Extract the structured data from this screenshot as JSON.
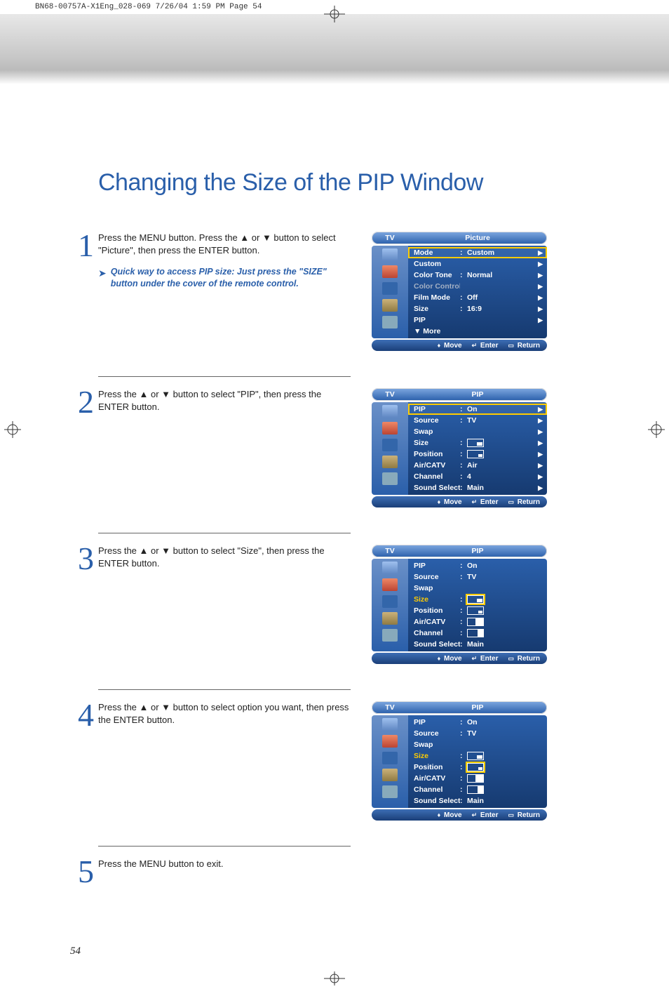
{
  "print_header": "BN68-00757A-X1Eng_028-069  7/26/04  1:59 PM  Page 54",
  "page_title": "Changing the Size of the PIP Window",
  "page_number": "54",
  "steps": [
    {
      "num": "1",
      "text": "Press the MENU button. Press the ▲ or ▼ button to select \"Picture\", then press the ENTER button.",
      "tip": "Quick way to access PIP size: Just press the \"SIZE\" button under the cover of the remote control."
    },
    {
      "num": "2",
      "text": "Press the ▲ or ▼ button to select \"PIP\", then press the ENTER button."
    },
    {
      "num": "3",
      "text": "Press the ▲ or ▼ button to select \"Size\", then press the ENTER button."
    },
    {
      "num": "4",
      "text": "Press the ▲ or ▼ button to select option you want, then press the ENTER button."
    },
    {
      "num": "5",
      "text": "Press the MENU button to exit."
    }
  ],
  "osd": {
    "tv_label": "TV",
    "footer": {
      "move": "Move",
      "enter": "Enter",
      "return": "Return"
    },
    "menu1": {
      "title": "Picture",
      "rows": [
        {
          "k": "Mode",
          "v": "Custom",
          "arr": true,
          "sel": true
        },
        {
          "k": "Custom",
          "v": "",
          "arr": true
        },
        {
          "k": "Color Tone",
          "v": "Normal",
          "arr": true
        },
        {
          "k": "Color Control",
          "v": "",
          "arr": true,
          "dim": true
        },
        {
          "k": "Film Mode",
          "v": "Off",
          "arr": true
        },
        {
          "k": "Size",
          "v": "16:9",
          "arr": true
        },
        {
          "k": "PIP",
          "v": "",
          "arr": true
        },
        {
          "k": "▼ More",
          "v": "",
          "arr": false
        }
      ]
    },
    "menu2": {
      "title": "PIP",
      "rows": [
        {
          "k": "PIP",
          "v": "On",
          "arr": true,
          "sel": true
        },
        {
          "k": "Source",
          "v": "TV",
          "arr": true
        },
        {
          "k": "Swap",
          "v": "",
          "arr": true
        },
        {
          "k": "Size",
          "v": "",
          "arr": true,
          "icon": "size-large"
        },
        {
          "k": "Position",
          "v": "",
          "arr": true,
          "icon": "pos"
        },
        {
          "k": "Air/CATV",
          "v": "Air",
          "arr": true
        },
        {
          "k": "Channel",
          "v": "4",
          "arr": true
        },
        {
          "k": "Sound Select",
          "v": "Main",
          "arr": true
        }
      ]
    },
    "menu3": {
      "title": "PIP",
      "rows": [
        {
          "k": "PIP",
          "v": "On"
        },
        {
          "k": "Source",
          "v": "TV"
        },
        {
          "k": "Swap",
          "v": ""
        },
        {
          "k": "Size",
          "v": "",
          "sizesel": true,
          "icon": "size-large",
          "sel_icon": true
        },
        {
          "k": "Position",
          "v": "",
          "icon": "size-med"
        },
        {
          "k": "Air/CATV",
          "v": "",
          "icon": "size-half"
        },
        {
          "k": "Channel",
          "v": "",
          "icon": "size-third"
        },
        {
          "k": "Sound Select",
          "v": "Main"
        }
      ]
    },
    "menu4": {
      "title": "PIP",
      "rows": [
        {
          "k": "PIP",
          "v": "On"
        },
        {
          "k": "Source",
          "v": "TV"
        },
        {
          "k": "Swap",
          "v": ""
        },
        {
          "k": "Size",
          "v": "",
          "sizesel": true,
          "icon": "size-large"
        },
        {
          "k": "Position",
          "v": "",
          "icon": "size-med",
          "sel_icon": true
        },
        {
          "k": "Air/CATV",
          "v": "",
          "icon": "size-half"
        },
        {
          "k": "Channel",
          "v": "",
          "icon": "size-third"
        },
        {
          "k": "Sound Select",
          "v": "Main"
        }
      ]
    }
  }
}
